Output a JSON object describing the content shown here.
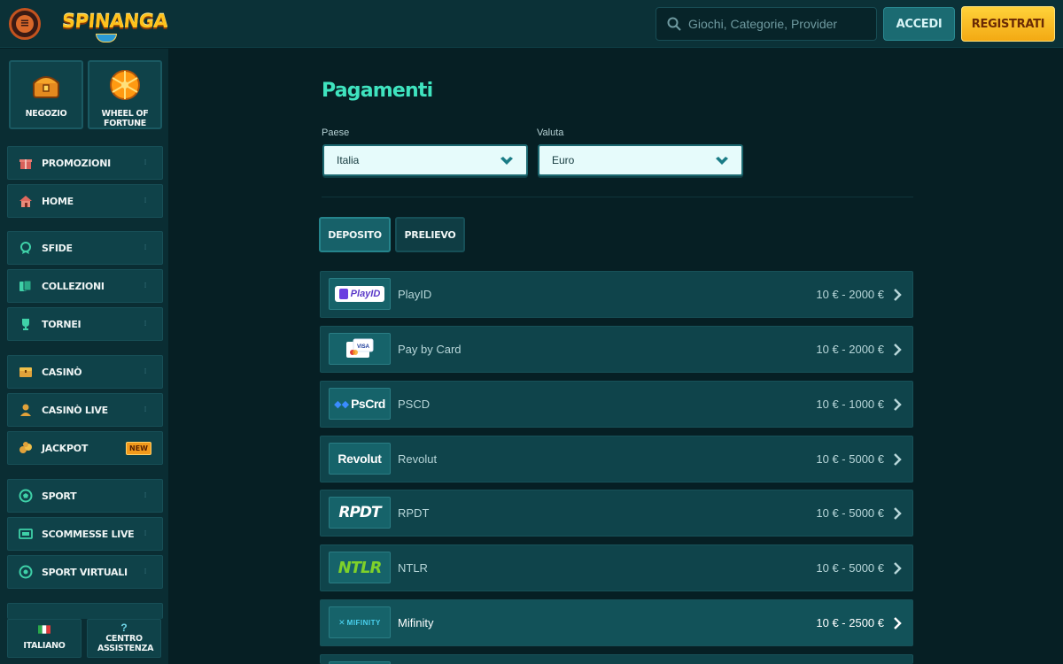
{
  "header": {
    "logo_text": "SPINANGA",
    "search_placeholder": "Giochi, Categorie, Provider",
    "login_label": "ACCEDI",
    "register_label": "REGISTRATI",
    "accent_color": "#3fe3bf",
    "register_color": "#f3a913"
  },
  "sidebar": {
    "tiles": [
      {
        "label": "NEGOZIO",
        "icon": "treasure-chest-icon"
      },
      {
        "label": "WHEEL OF FORTUNE",
        "icon": "fortune-wheel-icon"
      }
    ],
    "items": [
      {
        "label": "PROMOZIONI",
        "icon": "gift-icon"
      },
      {
        "label": "HOME",
        "icon": "home-icon"
      },
      {
        "label": "SFIDE",
        "icon": "medal-icon"
      },
      {
        "label": "COLLEZIONI",
        "icon": "cards-icon"
      },
      {
        "label": "TORNEI",
        "icon": "trophy-icon"
      },
      {
        "label": "CASINÒ",
        "icon": "chest-icon"
      },
      {
        "label": "CASINÒ LIVE",
        "icon": "dealer-icon"
      },
      {
        "label": "JACKPOT",
        "icon": "coins-icon",
        "badge": "NEW"
      },
      {
        "label": "SPORT",
        "icon": "soccer-ball-icon"
      },
      {
        "label": "SCOMMESSE LIVE",
        "icon": "live-tv-icon"
      },
      {
        "label": "SPORT VIRTUALI",
        "icon": "virtual-sport-icon"
      }
    ],
    "language_label": "ITALIANO",
    "help_label": "CENTRO ASSISTENZA"
  },
  "main": {
    "title": "Pagamenti",
    "country_label": "Paese",
    "country_value": "Italia",
    "currency_label": "Valuta",
    "currency_value": "Euro",
    "tabs": [
      {
        "label": "DEPOSITO",
        "active": true
      },
      {
        "label": "PRELIEVO",
        "active": false
      }
    ],
    "methods": [
      {
        "name": "PlayID",
        "range": "10 € - 2000 €",
        "logo_text": "PlayID"
      },
      {
        "name": "Pay by Card",
        "range": "10 € - 2000 €",
        "logo_text": "VISA"
      },
      {
        "name": "PSCD",
        "range": "10 € - 1000 €",
        "logo_text": "PsCrd"
      },
      {
        "name": "Revolut",
        "range": "10 € - 5000 €",
        "logo_text": "Revolut"
      },
      {
        "name": "RPDT",
        "range": "10 € - 5000 €",
        "logo_text": "RPDT"
      },
      {
        "name": "NTLR",
        "range": "10 € - 5000 €",
        "logo_text": "NTLR"
      },
      {
        "name": "Mifinity",
        "range": "10 € - 2500 €",
        "logo_text": "MIFINITY"
      }
    ]
  }
}
